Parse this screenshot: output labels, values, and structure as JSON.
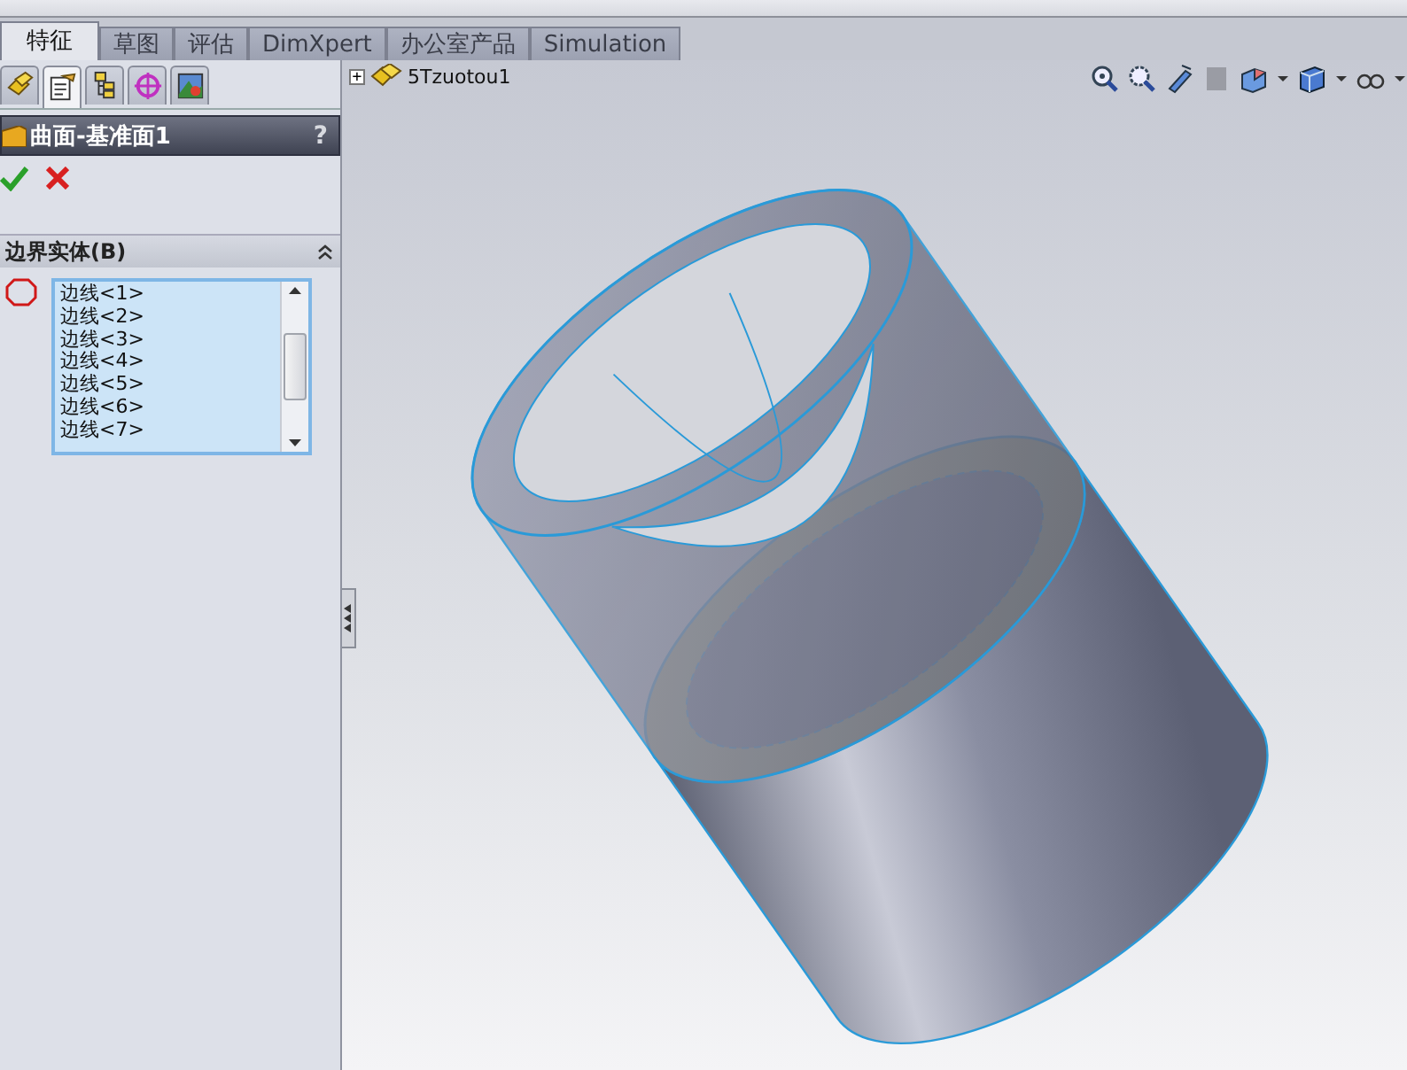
{
  "tabs": [
    {
      "label": "特征",
      "selected": true
    },
    {
      "label": "草图",
      "selected": false
    },
    {
      "label": "评估",
      "selected": false
    },
    {
      "label": "DimXpert",
      "selected": false
    },
    {
      "label": "办公室产品",
      "selected": false
    },
    {
      "label": "Simulation",
      "selected": false
    }
  ],
  "panel_tabs": [
    {
      "kind": "feature",
      "selected": false
    },
    {
      "kind": "property",
      "selected": true
    },
    {
      "kind": "config",
      "selected": false
    },
    {
      "kind": "dimxpert",
      "selected": false
    },
    {
      "kind": "display",
      "selected": false
    }
  ],
  "property_manager": {
    "title": "曲面-基准面1",
    "help": "?",
    "section": {
      "title": "边界实体(B)",
      "expanded": true,
      "items": [
        "边线<1>",
        "边线<2>",
        "边线<3>",
        "边线<4>",
        "边线<5>",
        "边线<6>",
        "边线<7>"
      ]
    }
  },
  "tree": {
    "root": "5Tzuotou1",
    "expanded": false,
    "expander": "+"
  }
}
